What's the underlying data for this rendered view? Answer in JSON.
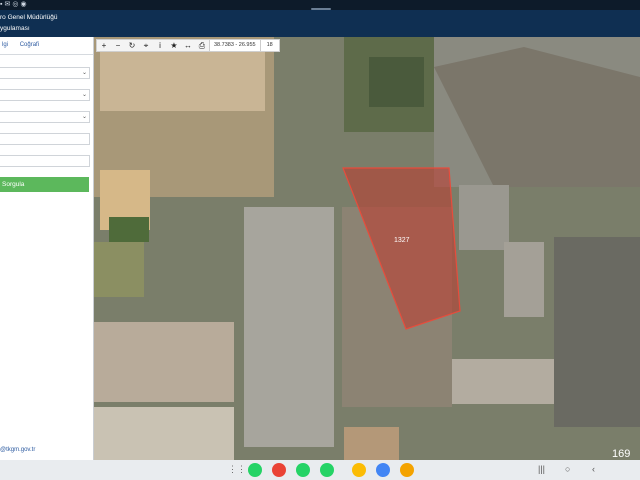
{
  "header": {
    "title_line1": "ro Genel Müdürlüğü",
    "title_line2": "ygulaması"
  },
  "sidebar": {
    "tabs": [
      {
        "label": "lgi"
      },
      {
        "label": "Coğrafi"
      }
    ],
    "search_button": "Sorgula",
    "footer_email": "@tkgm.gov.tr"
  },
  "map": {
    "toolbar": {
      "coordinates": "38.7383 - 26.955",
      "zoom": "18"
    },
    "parcel": {
      "label": "1327"
    }
  },
  "overlay": {
    "number": "169"
  },
  "colors": {
    "header": "#0f2f52",
    "search_button": "#5cb85c",
    "parcel_fill": "#c0392b"
  },
  "taskbar": {
    "apps": [
      {
        "name": "whatsapp-icon",
        "color": "#25d366"
      },
      {
        "name": "gmail-icon",
        "color": "#ea4335"
      },
      {
        "name": "whatsapp-icon",
        "color": "#25d366"
      },
      {
        "name": "whatsapp-icon",
        "color": "#25d366"
      },
      {
        "name": "chrome-icon",
        "color": "#fbbc05"
      },
      {
        "name": "chrome-icon",
        "color": "#4285f4"
      },
      {
        "name": "app-icon",
        "color": "#f4a300"
      },
      {
        "name": "app-icon",
        "color": "#e74c3c"
      }
    ]
  }
}
